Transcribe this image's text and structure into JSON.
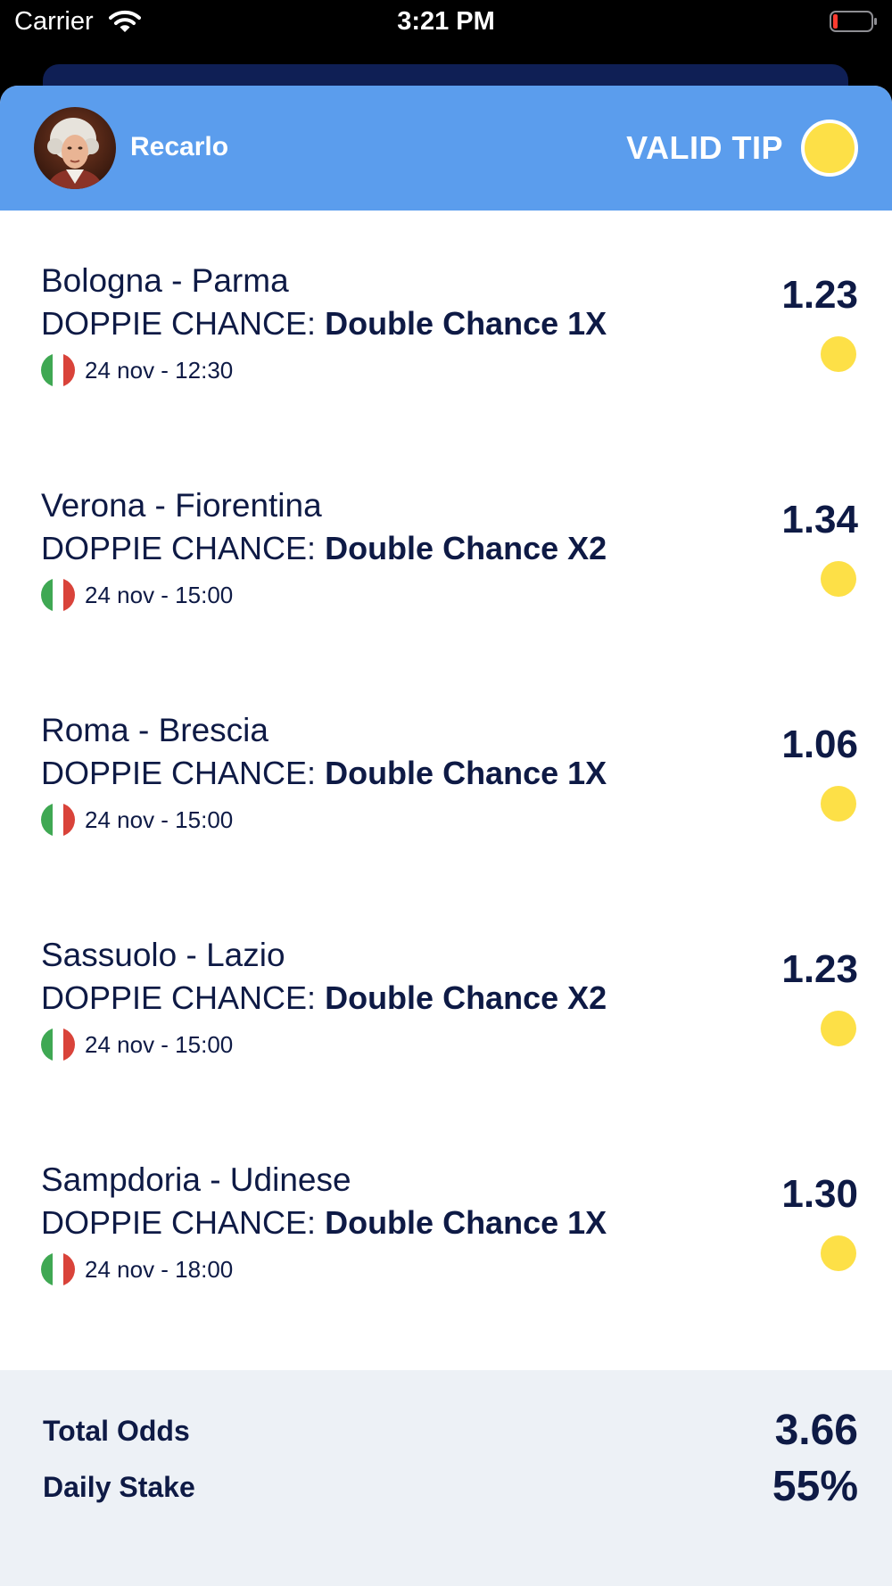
{
  "status_bar": {
    "carrier": "Carrier",
    "time": "3:21 PM",
    "battery_color": "#ff3b30"
  },
  "tip": {
    "username": "Recarlo",
    "status_label": "VALID TIP",
    "header_color": "#5b9ded",
    "status_color": "#fde047"
  },
  "matches": [
    {
      "teams": "Bologna - Parma",
      "market": "DOPPIE CHANCE:",
      "pick": "Double Chance 1X",
      "date": "24 nov - 12:30",
      "odds": "1.23",
      "flag": "italy-flag-icon"
    },
    {
      "teams": "Verona - Fiorentina",
      "market": "DOPPIE CHANCE:",
      "pick": "Double Chance X2",
      "date": "24 nov - 15:00",
      "odds": "1.34",
      "flag": "italy-flag-icon"
    },
    {
      "teams": "Roma - Brescia",
      "market": "DOPPIE CHANCE:",
      "pick": "Double Chance 1X",
      "date": "24 nov - 15:00",
      "odds": "1.06",
      "flag": "italy-flag-icon"
    },
    {
      "teams": "Sassuolo - Lazio",
      "market": "DOPPIE CHANCE:",
      "pick": "Double Chance X2",
      "date": "24 nov - 15:00",
      "odds": "1.23",
      "flag": "italy-flag-icon"
    },
    {
      "teams": "Sampdoria - Udinese",
      "market": "DOPPIE CHANCE:",
      "pick": "Double Chance 1X",
      "date": "24 nov - 18:00",
      "odds": "1.30",
      "flag": "italy-flag-icon"
    }
  ],
  "summary": {
    "total_odds_label": "Total Odds",
    "total_odds_value": "3.66",
    "daily_stake_label": "Daily Stake",
    "daily_stake_value": "55%"
  }
}
